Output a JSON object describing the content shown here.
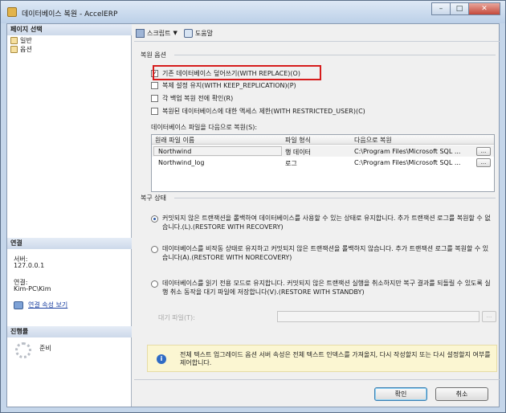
{
  "window": {
    "title": "데이터베이스 복원 - AccelERP",
    "minimize": "–",
    "maximize": "□",
    "close": "✕"
  },
  "left": {
    "page_select_header": "페이지 선택",
    "pages": [
      "일반",
      "옵션"
    ],
    "connection_header": "연결",
    "server_label": "서버:",
    "server_value": "127.0.0.1",
    "conn_label": "연결:",
    "conn_value": "Kim-PC\\Kim",
    "conn_props_link": "연결 속성 보기",
    "progress_header": "진행률",
    "progress_status": "준비"
  },
  "toolbar": {
    "script_label": "스크립트",
    "help_label": "도움말"
  },
  "restore_options": {
    "title": "복원 옵션",
    "checks": [
      {
        "label": "기존 데이터베이스 덮어쓰기(WITH REPLACE)(O)",
        "checked": true
      },
      {
        "label": "복제 설정 유지(WITH KEEP_REPLICATION)(P)",
        "checked": false
      },
      {
        "label": "각 백업 복원 전에 확인(R)",
        "checked": false
      },
      {
        "label": "복원된 데이터베이스에 대한 액세스 제한(WITH RESTRICTED_USER)(C)",
        "checked": false
      }
    ],
    "files_label": "데이터베이스 파일을 다음으로 복원(S):",
    "grid_headers": [
      "원래 파일 이름",
      "파일 형식",
      "다음으로 복원"
    ],
    "grid_rows": [
      {
        "name": "Northwind",
        "type": "행 데이터",
        "path": "C:\\Program Files\\Microsoft SQL ...",
        "browse": "..."
      },
      {
        "name": "Northwind_log",
        "type": "로그",
        "path": "C:\\Program Files\\Microsoft SQL ...",
        "browse": "..."
      }
    ]
  },
  "recovery": {
    "title": "복구 상태",
    "options": [
      {
        "label": "커밋되지 않은 트랜잭션을 롤백하여 데이터베이스를 사용할 수 있는 상태로 유지합니다. 추가 트랜잭션 로그를 복원할 수 없습니다.(L).(RESTORE WITH RECOVERY)",
        "selected": true
      },
      {
        "label": "데이터베이스를 비작동 상태로 유지하고 커밋되지 않은 트랜잭션을 롤백하지 않습니다. 추가 트랜잭션 로그를 복원할 수 있습니다(A).(RESTORE WITH NORECOVERY)",
        "selected": false
      },
      {
        "label": "데이터베이스를 읽기 전용 모드로 유지합니다. 커밋되지 않은 트랜잭션 실행을 취소하지만 복구 결과를 되돌릴 수 있도록 실행 취소 동작을 대기 파일에 저장합니다(V).(RESTORE WITH STANDBY)",
        "selected": false
      }
    ],
    "standby_label": "대기 파일(T):",
    "standby_value": "",
    "standby_browse": "..."
  },
  "info": {
    "icon": "i",
    "text": "전체 텍스트 업그레이드 옵션 서버 속성은 전체 텍스트 인덱스를 가져올지, 다시 작성할지 또는 다시 설정할지 여부를 제어합니다."
  },
  "buttons": {
    "ok": "확인",
    "cancel": "취소"
  },
  "colors": {
    "highlight_border": "#d61c1c",
    "link": "#1a3fa0",
    "info_background": "#fbf6d2"
  }
}
